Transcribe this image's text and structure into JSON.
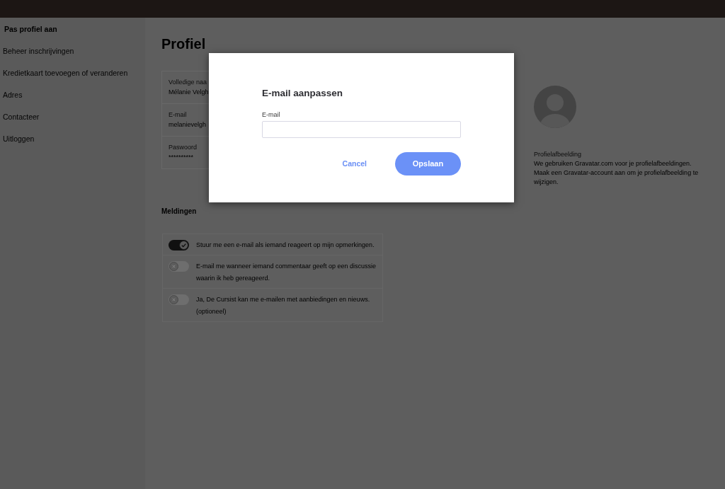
{
  "sidebar": {
    "items": [
      {
        "label": "Pas profiel aan",
        "selected": true
      },
      {
        "label": "Beheer inschrijvingen",
        "selected": false
      },
      {
        "label": "Kredietkaart toevoegen of veranderen",
        "selected": false
      },
      {
        "label": "Adres",
        "selected": false
      },
      {
        "label": "Contacteer",
        "selected": false
      },
      {
        "label": "Uitloggen",
        "selected": false
      }
    ]
  },
  "profile": {
    "title": "Profiel",
    "fields": [
      {
        "label": "Volledige naa",
        "value": "Mélanie Velgh"
      },
      {
        "label": "E-mail",
        "value": "melanievelgh"
      },
      {
        "label": "Paswoord",
        "value": "**********"
      }
    ]
  },
  "picture": {
    "label": "Profielafbeelding",
    "description": "We gebruiken Gravatar.com voor je profielafbeeldingen. Maak een Gravatar-account aan om je profielafbeelding te wijzigen."
  },
  "notifications": {
    "title": "Meldingen",
    "items": [
      {
        "label": "Stuur me een e-mail als iemand reageert op mijn opmerkingen.",
        "on": true
      },
      {
        "label": "E-mail me wanneer iemand commentaar geeft op een discussie waarin ik heb gereageerd.",
        "on": false
      },
      {
        "label": "Ja, De Cursist kan me e-mailen met aanbiedingen en nieuws. (optioneel)",
        "on": false
      }
    ]
  },
  "dialog": {
    "title": "E-mail aanpassen",
    "field": {
      "label": "E-mail"
    },
    "buttons": [
      {
        "label": "Cancel",
        "kind": "link"
      },
      {
        "label": "Opslaan",
        "kind": "primary"
      }
    ]
  }
}
